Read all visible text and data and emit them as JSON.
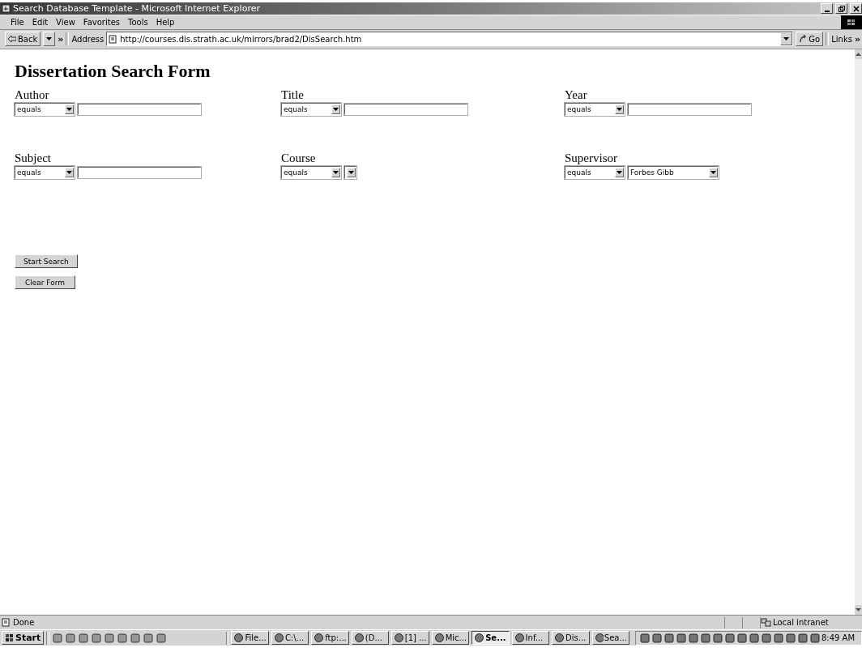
{
  "window": {
    "title": "Search Database Template - Microsoft Internet Explorer"
  },
  "menu": [
    "File",
    "Edit",
    "View",
    "Favorites",
    "Tools",
    "Help"
  ],
  "toolbar": {
    "back": "Back",
    "more": "»",
    "address_label": "Address",
    "url": "http://courses.dis.strath.ac.uk/mirrors/brad2/DisSearch.htm",
    "go": "Go",
    "links": "Links",
    "links_more": "»"
  },
  "page": {
    "heading": "Dissertation Search Form",
    "fields": [
      {
        "label": "Author",
        "operator": "equals",
        "kind": "text"
      },
      {
        "label": "Title",
        "operator": "equals",
        "kind": "text"
      },
      {
        "label": "Year",
        "operator": "equals",
        "kind": "text"
      },
      {
        "label": "Subject",
        "operator": "equals",
        "kind": "text"
      },
      {
        "label": "Course",
        "operator": "equals",
        "kind": "select"
      },
      {
        "label": "Supervisor",
        "operator": "equals",
        "kind": "select",
        "value": "Forbes Gibb"
      }
    ],
    "buttons": [
      "Start Search",
      "Clear Form"
    ]
  },
  "status_bar": {
    "text": "Done",
    "zone": "Local intranet"
  },
  "taskbar": {
    "start": "Start",
    "tasks": [
      {
        "label": "File...",
        "selected": false
      },
      {
        "label": "C:\\...",
        "selected": false
      },
      {
        "label": "ftp:...",
        "selected": false
      },
      {
        "label": "(D...",
        "selected": false
      },
      {
        "label": "[1] ...",
        "selected": false
      },
      {
        "label": "Mic...",
        "selected": false
      },
      {
        "label": "Se...",
        "selected": true
      },
      {
        "label": "Inf...",
        "selected": false
      },
      {
        "label": "Dis...",
        "selected": false
      },
      {
        "label": "Sea...",
        "selected": false
      }
    ],
    "clock": "8:49 AM"
  }
}
